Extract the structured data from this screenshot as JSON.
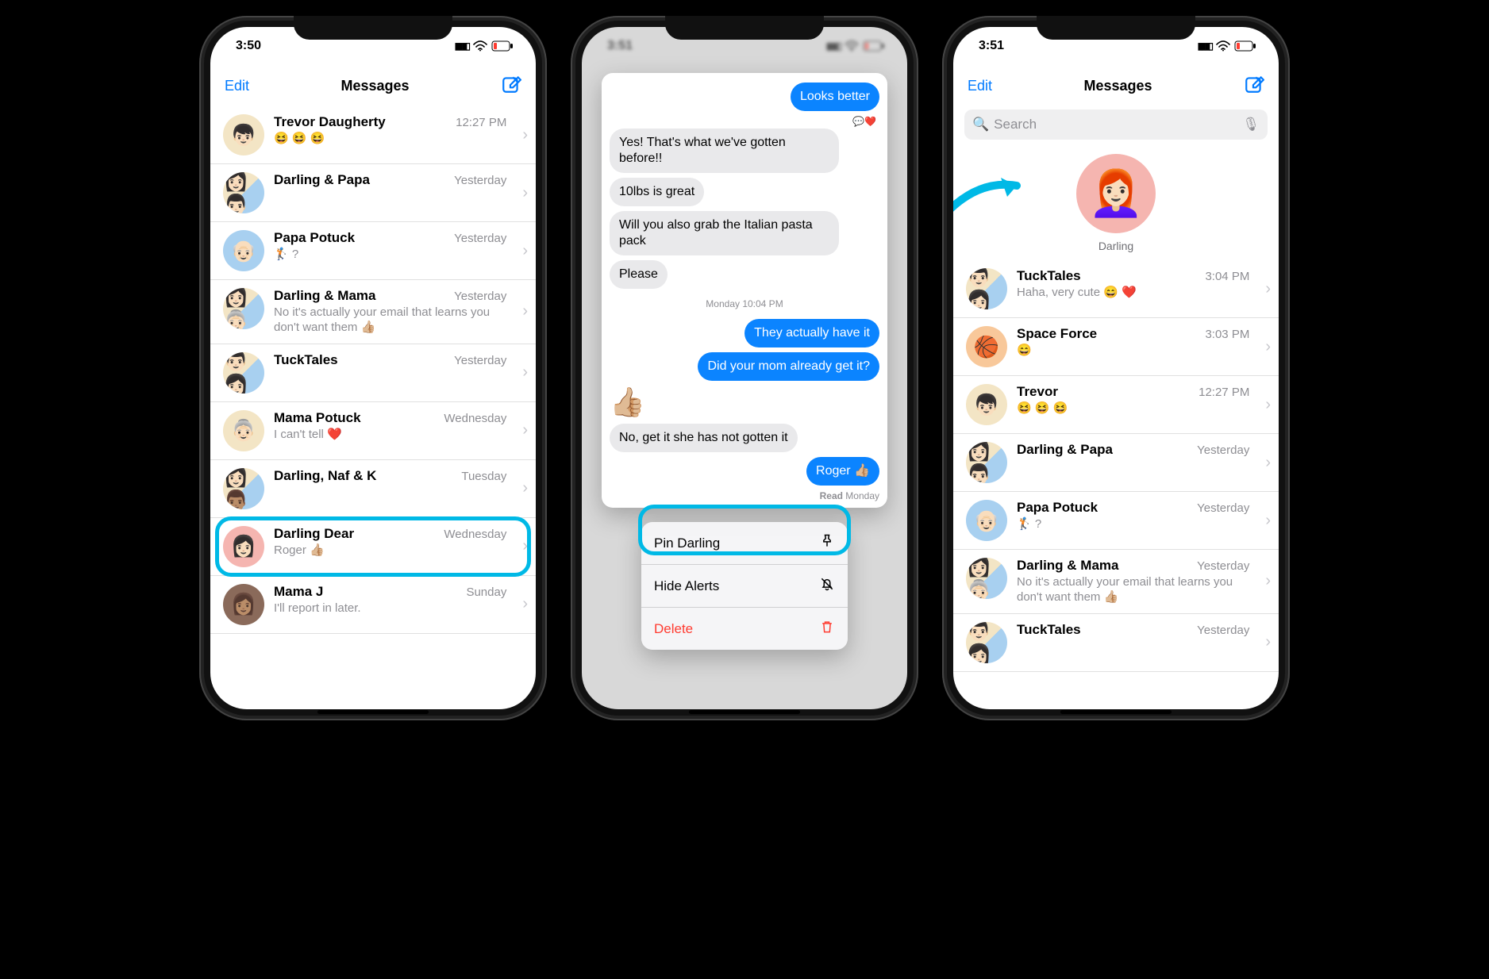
{
  "phones": {
    "p1": {
      "time": "3:50",
      "edit": "Edit",
      "title": "Messages",
      "conversations": [
        {
          "name": "Trevor Daugherty",
          "time": "12:27 PM",
          "preview": "😆 😆 😆"
        },
        {
          "name": "Darling & Papa",
          "time": "Yesterday",
          "preview": ""
        },
        {
          "name": "Papa Potuck",
          "time": "Yesterday",
          "preview": "🏌🏼 ?"
        },
        {
          "name": "Darling & Mama",
          "time": "Yesterday",
          "preview": "No it's actually your email that learns you don't want them 👍🏼"
        },
        {
          "name": "TuckTales",
          "time": "Yesterday",
          "preview": ""
        },
        {
          "name": "Mama Potuck",
          "time": "Wednesday",
          "preview": "I can't tell ❤️"
        },
        {
          "name": "Darling, Naf & K",
          "time": "Tuesday",
          "preview": ""
        },
        {
          "name": "Darling Dear",
          "time": "Wednesday",
          "preview": "Roger 👍🏼"
        },
        {
          "name": "Mama J",
          "time": "Sunday",
          "preview": "I'll report in later."
        }
      ]
    },
    "p2": {
      "time": "3:51",
      "messages": {
        "sent_top": "Looks better",
        "recv1": "Yes! That's what we've gotten before!!",
        "recv2": "10lbs is great",
        "recv3": "Will you also grab the Italian pasta pack",
        "recv4": "Please",
        "ts": "Monday 10:04 PM",
        "sent1": "They actually have it",
        "sent2": "Did your mom already get it?",
        "react": "👍🏼",
        "recv5": "No, get it she has not gotten it",
        "sent3": "Roger 👍🏼",
        "read_prefix": "Read",
        "read_day": "Monday"
      },
      "menu": {
        "pin": "Pin Darling",
        "hide": "Hide Alerts",
        "delete": "Delete"
      }
    },
    "p3": {
      "time": "3:51",
      "edit": "Edit",
      "title": "Messages",
      "search_placeholder": "Search",
      "pinned_label": "Darling",
      "conversations": [
        {
          "name": "TuckTales",
          "time": "3:04 PM",
          "preview": "Haha, very cute 😄 ❤️"
        },
        {
          "name": "Space Force",
          "time": "3:03 PM",
          "preview": "😄"
        },
        {
          "name": "Trevor",
          "time": "12:27 PM",
          "preview": "😆 😆 😆"
        },
        {
          "name": "Darling & Papa",
          "time": "Yesterday",
          "preview": ""
        },
        {
          "name": "Papa Potuck",
          "time": "Yesterday",
          "preview": "🏌🏼 ?"
        },
        {
          "name": "Darling & Mama",
          "time": "Yesterday",
          "preview": "No it's actually your email that learns you don't want them 👍🏼"
        },
        {
          "name": "TuckTales",
          "time": "Yesterday",
          "preview": ""
        }
      ]
    }
  }
}
